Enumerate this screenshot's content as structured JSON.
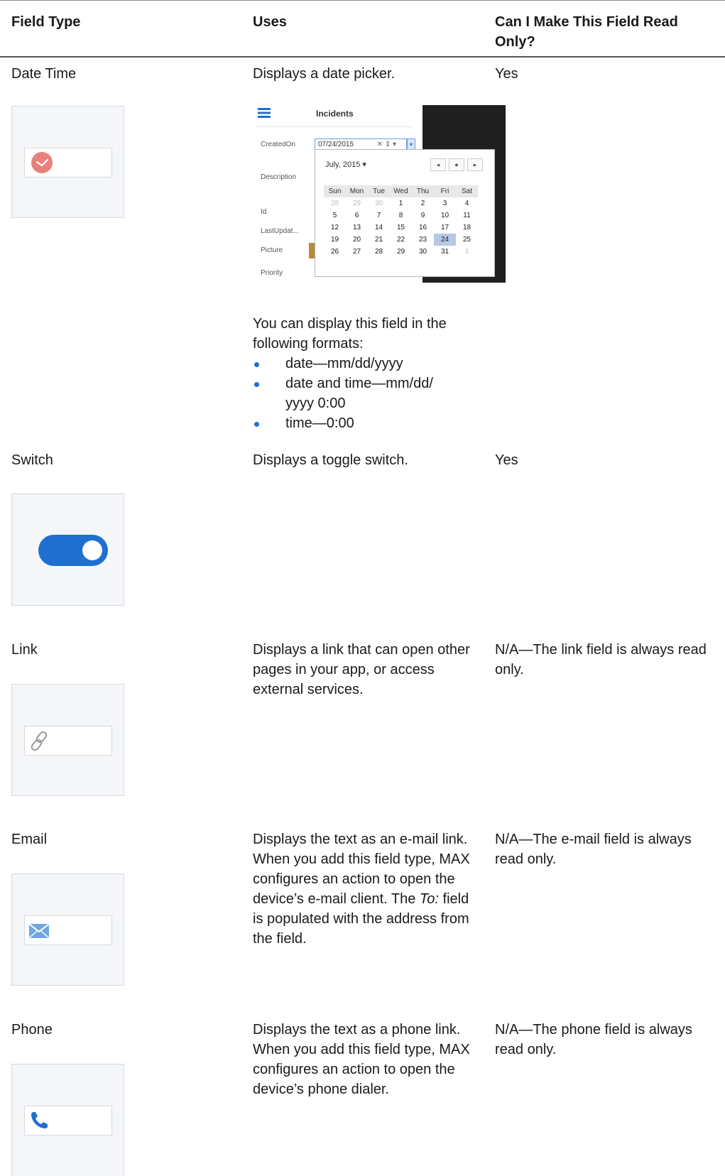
{
  "headers": {
    "field_type": "Field Type",
    "uses": "Uses",
    "read_only": "Can I Make This Field Read Only?"
  },
  "rows": [
    {
      "name": "Date Time",
      "uses": "Displays a date picker.",
      "read_only": "Yes",
      "formats_intro": "You can display this field in the following formats:",
      "formats": [
        "date—mm/dd/yyyy",
        "date and time—mm/dd/ yyyy 0:00",
        "time—0:00"
      ]
    },
    {
      "name": "Switch",
      "uses": "Displays a toggle switch.",
      "read_only": "Yes"
    },
    {
      "name": "Link",
      "uses": "Displays a link that can open other pages in your app, or access external services.",
      "read_only": "N/A—The link field is always read only."
    },
    {
      "name": "Email",
      "uses_before": "Displays the text as an e-mail link. When you add this field type, MAX configures an action to open the device’s e-mail client. The ",
      "uses_em": "To:",
      "uses_after": " field is populated with the address from the field.",
      "read_only": "N/A—The e-mail field is always read only."
    },
    {
      "name": "Phone",
      "uses": "Displays the text as a phone link. When you add this field type, MAX configures an action to open the device’s phone dialer.",
      "read_only": "N/A—The phone field is always read only."
    }
  ],
  "calendar": {
    "title": "Incidents",
    "fields": [
      "CreatedOn",
      "Description",
      "Id",
      "LastUpdat...",
      "Picture",
      "Priority"
    ],
    "date_value": "07/24/2015",
    "month_label": "July, 2015 ▾",
    "weekdays": [
      "Sun",
      "Mon",
      "Tue",
      "Wed",
      "Thu",
      "Fri",
      "Sat"
    ],
    "weeks": [
      [
        "28",
        "29",
        "30",
        "1",
        "2",
        "3",
        "4"
      ],
      [
        "5",
        "6",
        "7",
        "8",
        "9",
        "10",
        "11"
      ],
      [
        "12",
        "13",
        "14",
        "15",
        "16",
        "17",
        "18"
      ],
      [
        "19",
        "20",
        "21",
        "22",
        "23",
        "24",
        "25"
      ],
      [
        "26",
        "27",
        "28",
        "29",
        "30",
        "31",
        "1"
      ]
    ],
    "selected_day": "24"
  },
  "colors": {
    "clock": "#e8817b",
    "switch": "#1f6fd0",
    "bullet": "#1f6fd0",
    "mail": "#6fa7e0",
    "phone": "#1f6fd0"
  },
  "icons": [
    "clock-icon",
    "toggle-switch-icon",
    "link-icon",
    "envelope-icon",
    "phone-icon"
  ]
}
